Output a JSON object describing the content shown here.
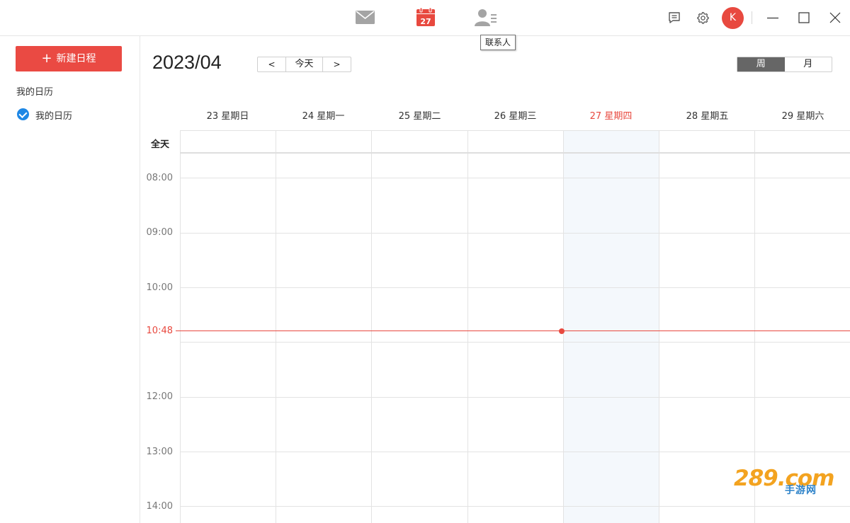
{
  "topbar": {
    "nav": [
      {
        "icon": "mail-icon"
      },
      {
        "icon": "calendar-icon",
        "date": "27",
        "active": true
      },
      {
        "icon": "contacts-icon"
      }
    ],
    "tooltip": "联系人",
    "avatar_letter": "K",
    "colors": {
      "accent": "#e8493f",
      "icon_inactive": "#9a9a9a"
    }
  },
  "sidebar": {
    "new_button": "新建日程",
    "section_title": "我的日历",
    "calendars": [
      {
        "label": "我的日历",
        "checked": true,
        "color": "#1e87e5"
      }
    ]
  },
  "header": {
    "month": "2023/04",
    "prev": "<",
    "today": "今天",
    "next": ">",
    "views": [
      "周",
      "月"
    ],
    "active_view": "周"
  },
  "week": {
    "days": [
      "23 星期日",
      "24 星期一",
      "25 星期二",
      "26 星期三",
      "27 星期四",
      "28 星期五",
      "29 星期六"
    ],
    "today_index": 4,
    "allday_label": "全天",
    "hours": [
      "08:00",
      "09:00",
      "10:00",
      "12:00",
      "13:00",
      "14:00"
    ],
    "now": "10:48"
  },
  "watermark": {
    "main": "289.com",
    "sub": "手游网"
  }
}
